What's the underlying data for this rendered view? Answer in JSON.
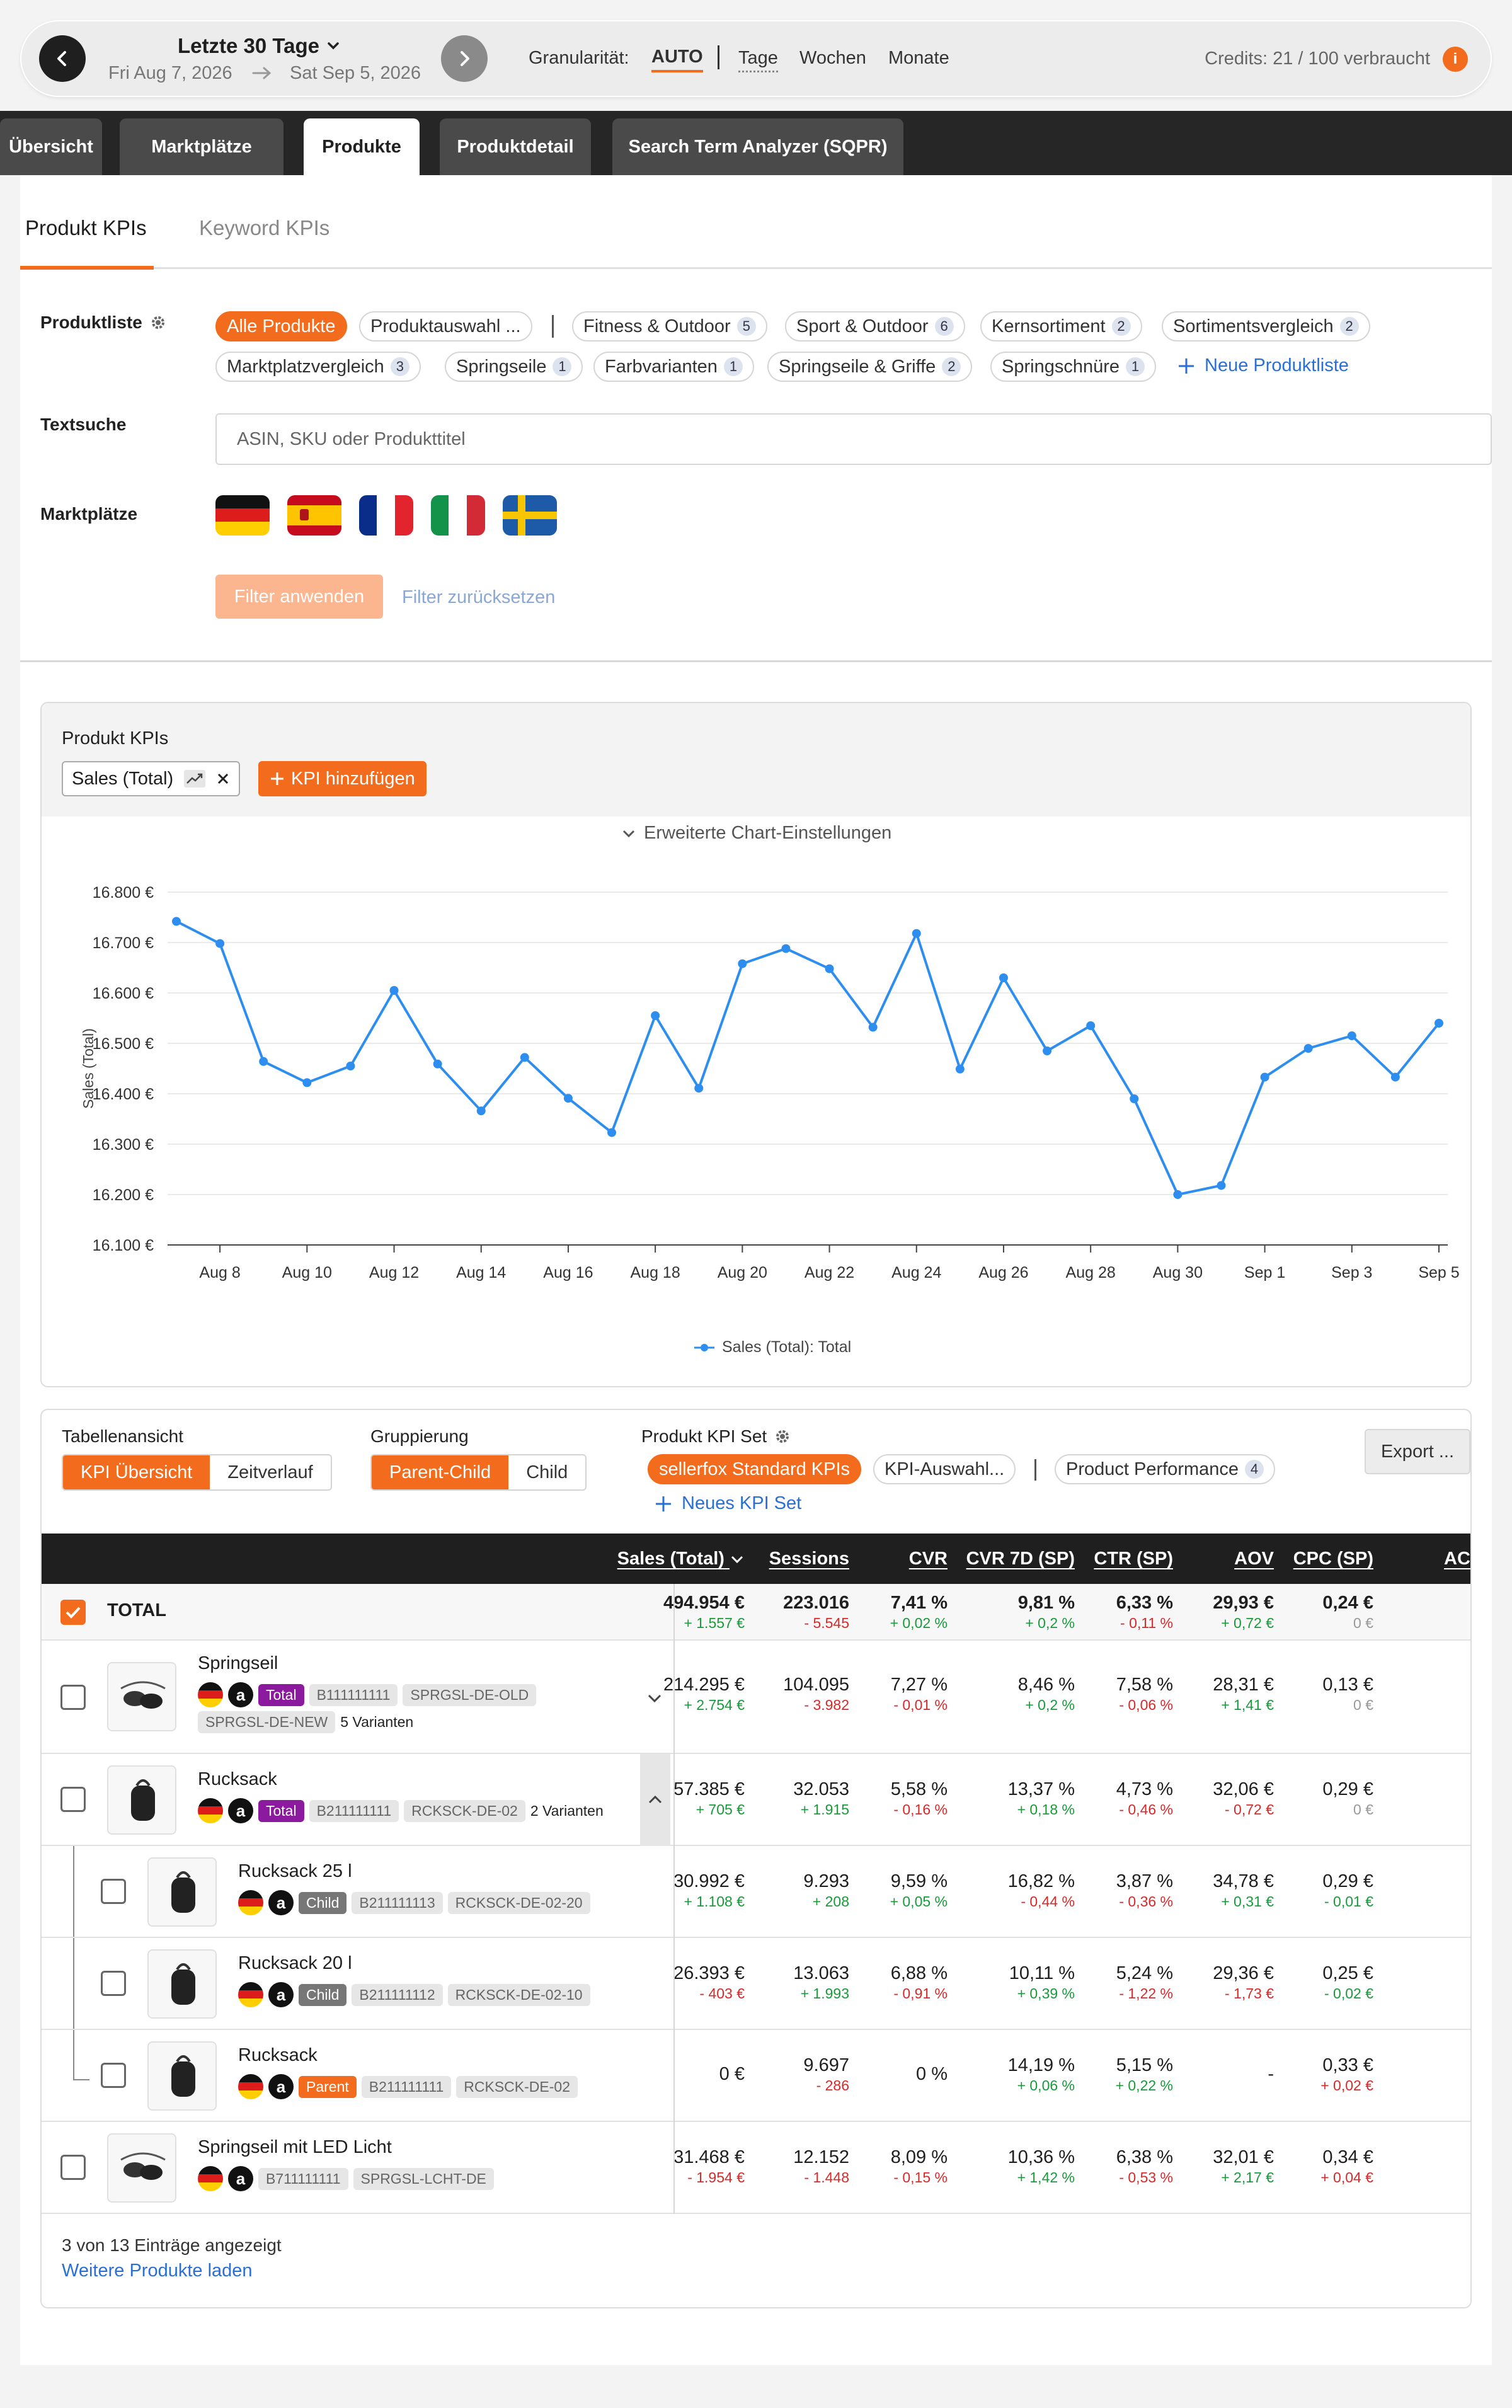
{
  "header": {
    "date_range_title": "Letzte 30 Tage",
    "date_from": "Fri Aug 7, 2026",
    "date_to": "Sat Sep 5, 2026",
    "granularity_label": "Granularität:",
    "granularity_options": [
      "AUTO",
      "Tage",
      "Wochen",
      "Monate"
    ],
    "granularity_selected": "AUTO",
    "credits": "Credits: 21 / 100 verbraucht",
    "credits_info": "i"
  },
  "nav": {
    "tabs": [
      "Übersicht",
      "Marktplätze",
      "Produkte",
      "Produktdetail",
      "Search Term Analyzer (SQPR)"
    ],
    "active": "Produkte"
  },
  "subtabs": {
    "items": [
      "Produkt KPIs",
      "Keyword KPIs"
    ],
    "active": "Produkt KPIs"
  },
  "filters": {
    "produktliste_label": "Produktliste",
    "lists": [
      {
        "label": "Alle Produkte",
        "selected": true
      },
      {
        "label": "Produktauswahl ..."
      },
      {
        "label": "Fitness & Outdoor",
        "count": "5"
      },
      {
        "label": "Sport & Outdoor",
        "count": "6"
      },
      {
        "label": "Kernsortiment",
        "count": "2"
      },
      {
        "label": "Sortimentsvergleich",
        "count": "2"
      },
      {
        "label": "Marktplatzvergleich",
        "count": "3"
      },
      {
        "label": "Springseile",
        "count": "1"
      },
      {
        "label": "Farbvarianten",
        "count": "1"
      },
      {
        "label": "Springseile & Griffe",
        "count": "2"
      },
      {
        "label": "Springschnüre",
        "count": "1"
      }
    ],
    "new_list": "Neue Produktliste",
    "textsuche_label": "Textsuche",
    "search_placeholder": "ASIN, SKU oder Produkttitel",
    "marktplaetze_label": "Marktplätze",
    "marketplaces": [
      "de-flag-icon",
      "es-flag-icon",
      "fr-flag-icon",
      "it-flag-icon",
      "se-flag-icon"
    ],
    "apply": "Filter anwenden",
    "reset": "Filter zurücksetzen"
  },
  "kpi_card": {
    "title": "Produkt KPIs",
    "selected_kpi": "Sales (Total)",
    "add_kpi": "KPI hinzufügen",
    "chart_settings": "Erweiterte Chart-Einstellungen"
  },
  "chart_data": {
    "type": "line",
    "ylabel": "Sales (Total)",
    "ylim": [
      16100,
      16800
    ],
    "yticks": [
      "16.100 €",
      "16.200 €",
      "16.300 €",
      "16.400 €",
      "16.500 €",
      "16.600 €",
      "16.700 €",
      "16.800 €"
    ],
    "xticks": [
      "Aug 8",
      "Aug 10",
      "Aug 12",
      "Aug 14",
      "Aug 16",
      "Aug 18",
      "Aug 20",
      "Aug 22",
      "Aug 24",
      "Aug 26",
      "Aug 28",
      "Aug 30",
      "Sep 1",
      "Sep 3",
      "Sep 5"
    ],
    "x": [
      "Aug 7",
      "Aug 8",
      "Aug 9",
      "Aug 10",
      "Aug 11",
      "Aug 12",
      "Aug 13",
      "Aug 14",
      "Aug 15",
      "Aug 16",
      "Aug 17",
      "Aug 18",
      "Aug 19",
      "Aug 20",
      "Aug 21",
      "Aug 22",
      "Aug 23",
      "Aug 24",
      "Aug 25",
      "Aug 26",
      "Aug 27",
      "Aug 28",
      "Aug 29",
      "Aug 30",
      "Aug 31",
      "Sep 1",
      "Sep 2",
      "Sep 3",
      "Sep 4",
      "Sep 5"
    ],
    "series": [
      {
        "name": "Sales (Total): Total",
        "color": "#2d8ef0",
        "values": [
          16742,
          16698,
          16464,
          16422,
          16455,
          16605,
          16459,
          16366,
          16472,
          16391,
          16323,
          16555,
          16411,
          16658,
          16688,
          16648,
          16532,
          16718,
          16449,
          16630,
          16485,
          16535,
          16390,
          16200,
          16218,
          16433,
          16490,
          16515,
          16433,
          16540
        ]
      }
    ],
    "grid": true,
    "legend": "bottom"
  },
  "table_card": {
    "tabellenansicht_label": "Tabellenansicht",
    "views": [
      "KPI Übersicht",
      "Zeitverlauf"
    ],
    "gruppierung_label": "Gruppierung",
    "groupings": [
      "Parent-Child",
      "Child"
    ],
    "kpiset_label": "Produkt KPI Set",
    "kpisets": [
      {
        "label": "sellerfox Standard KPIs",
        "selected": true
      },
      {
        "label": "KPI-Auswahl..."
      },
      {
        "label": "Product Performance",
        "count": "4"
      }
    ],
    "new_kpiset": "Neues KPI Set",
    "export": "Export ...",
    "columns": [
      "Sales (Total)",
      "Sessions",
      "CVR",
      "CVR 7D (SP)",
      "CTR (SP)",
      "AOV",
      "CPC (SP)",
      "ACO"
    ],
    "total": {
      "label": "TOTAL",
      "values": [
        [
          "494.954 €",
          "+ 1.557 €",
          "pos"
        ],
        [
          "223.016",
          "- 5.545",
          "neg"
        ],
        [
          "7,41 %",
          "+ 0,02 %",
          "pos"
        ],
        [
          "9,81 %",
          "+ 0,2 %",
          "pos"
        ],
        [
          "6,33 %",
          "- 0,11 %",
          "neg"
        ],
        [
          "29,93 €",
          "+ 0,72 €",
          "pos"
        ],
        [
          "0,24 €",
          "0 €",
          "zero"
        ]
      ]
    },
    "rows": [
      {
        "name": "Springseil",
        "badge": "Total",
        "asin": "B111111111",
        "skus": [
          "SPRGSL-DE-OLD",
          "SPRGSL-DE-NEW"
        ],
        "variants": "5 Varianten",
        "values": [
          [
            "214.295 €",
            "+ 2.754 €",
            "pos"
          ],
          [
            "104.095",
            "- 3.982",
            "neg"
          ],
          [
            "7,27 %",
            "- 0,01 %",
            "neg"
          ],
          [
            "8,46 %",
            "+ 0,2 %",
            "pos"
          ],
          [
            "7,58 %",
            "- 0,06 %",
            "neg"
          ],
          [
            "28,31 €",
            "+ 1,41 €",
            "pos"
          ],
          [
            "0,13 €",
            "0 €",
            "zero"
          ]
        ]
      },
      {
        "name": "Rucksack",
        "badge": "Total",
        "asin": "B211111111",
        "skus": [
          "RCKSCK-DE-02"
        ],
        "variants": "2 Varianten",
        "values": [
          [
            "57.385 €",
            "+ 705 €",
            "pos"
          ],
          [
            "32.053",
            "+ 1.915",
            "pos"
          ],
          [
            "5,58 %",
            "- 0,16 %",
            "neg"
          ],
          [
            "13,37 %",
            "+ 0,18 %",
            "pos"
          ],
          [
            "4,73 %",
            "- 0,46 %",
            "neg"
          ],
          [
            "32,06 €",
            "- 0,72 €",
            "neg"
          ],
          [
            "0,29 €",
            "0 €",
            "zero"
          ]
        ]
      },
      {
        "name": "Rucksack 25 l",
        "badge": "Child",
        "asin": "B211111113",
        "skus": [
          "RCKSCK-DE-02-20"
        ],
        "values": [
          [
            "30.992 €",
            "+ 1.108 €",
            "pos"
          ],
          [
            "9.293",
            "+ 208",
            "pos"
          ],
          [
            "9,59 %",
            "+ 0,05 %",
            "pos"
          ],
          [
            "16,82 %",
            "- 0,44 %",
            "neg"
          ],
          [
            "3,87 %",
            "- 0,36 %",
            "neg"
          ],
          [
            "34,78 €",
            "+ 0,31 €",
            "pos"
          ],
          [
            "0,29 €",
            "- 0,01 €",
            "pos"
          ]
        ]
      },
      {
        "name": "Rucksack 20 l",
        "badge": "Child",
        "asin": "B211111112",
        "skus": [
          "RCKSCK-DE-02-10"
        ],
        "values": [
          [
            "26.393 €",
            "- 403 €",
            "neg"
          ],
          [
            "13.063",
            "+ 1.993",
            "pos"
          ],
          [
            "6,88 %",
            "- 0,91 %",
            "neg"
          ],
          [
            "10,11 %",
            "+ 0,39 %",
            "pos"
          ],
          [
            "5,24 %",
            "- 1,22 %",
            "neg"
          ],
          [
            "29,36 €",
            "- 1,73 €",
            "neg"
          ],
          [
            "0,25 €",
            "- 0,02 €",
            "pos"
          ]
        ]
      },
      {
        "name": "Rucksack",
        "badge": "Parent",
        "asin": "B211111111",
        "skus": [
          "RCKSCK-DE-02"
        ],
        "values": [
          [
            "0 €",
            "",
            "zero"
          ],
          [
            "9.697",
            "- 286",
            "neg"
          ],
          [
            "0 %",
            "",
            "zero"
          ],
          [
            "14,19 %",
            "+ 0,06 %",
            "pos"
          ],
          [
            "5,15 %",
            "+ 0,22 %",
            "pos"
          ],
          [
            "-",
            "",
            "zero"
          ],
          [
            "0,33 €",
            "+ 0,02 €",
            "neg"
          ]
        ]
      },
      {
        "name": "Springseil mit LED Licht",
        "badge": "",
        "asin": "B711111111",
        "skus": [
          "SPRGSL-LCHT-DE"
        ],
        "values": [
          [
            "31.468 €",
            "- 1.954 €",
            "neg"
          ],
          [
            "12.152",
            "- 1.448",
            "neg"
          ],
          [
            "8,09 %",
            "- 0,15 %",
            "neg"
          ],
          [
            "10,36 %",
            "+ 1,42 %",
            "pos"
          ],
          [
            "6,38 %",
            "- 0,53 %",
            "neg"
          ],
          [
            "32,01 €",
            "+ 2,17 €",
            "pos"
          ],
          [
            "0,34 €",
            "+ 0,04 €",
            "neg"
          ]
        ]
      }
    ],
    "entries_info": "3 von 13 Einträge angezeigt",
    "load_more": "Weitere Produkte laden"
  }
}
